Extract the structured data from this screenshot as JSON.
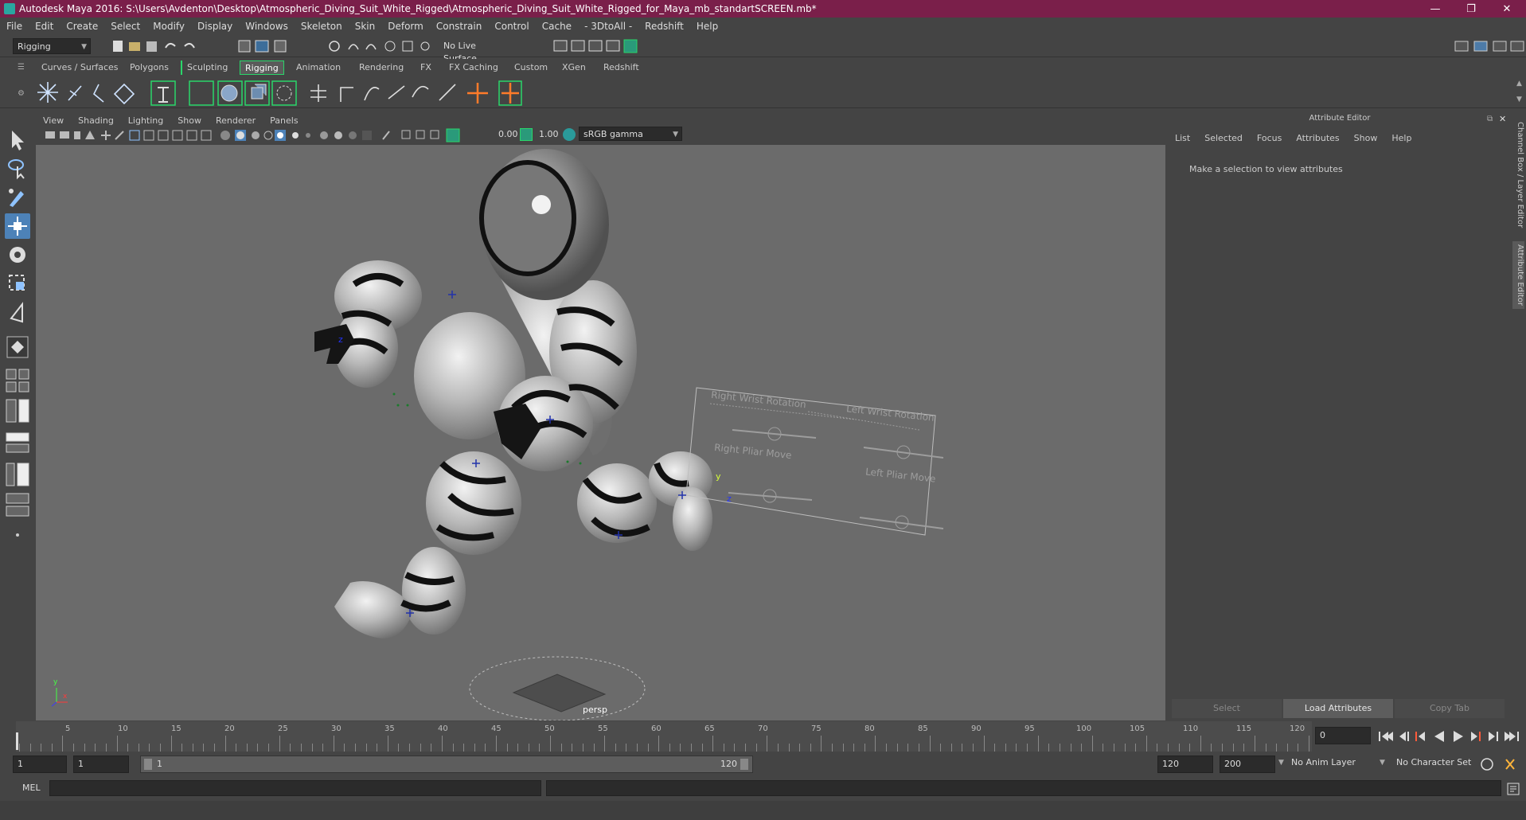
{
  "window": {
    "title": "Autodesk Maya 2016: S:\\Users\\Avdenton\\Desktop\\Atmospheric_Diving_Suit_White_Rigged\\Atmospheric_Diving_Suit_White_Rigged_for_Maya_mb_standartSCREEN.mb*",
    "minimize": "—",
    "maximize": "❐",
    "close": "✕"
  },
  "menubar": [
    "File",
    "Edit",
    "Create",
    "Select",
    "Modify",
    "Display",
    "Windows",
    "Skeleton",
    "Skin",
    "Deform",
    "Constrain",
    "Control",
    "Cache",
    "- 3DtoAll -",
    "Redshift",
    "Help"
  ],
  "statusline": {
    "mode": "Rigging",
    "live_surface": "No Live Surface"
  },
  "shelf_tabs": [
    {
      "label": "Curves / Surfaces",
      "active": false
    },
    {
      "label": "Polygons",
      "active": false
    },
    {
      "label": "Sculpting",
      "active": false
    },
    {
      "label": "Rigging",
      "active": true
    },
    {
      "label": "Animation",
      "active": false
    },
    {
      "label": "Rendering",
      "active": false
    },
    {
      "label": "FX",
      "active": false
    },
    {
      "label": "FX Caching",
      "active": false
    },
    {
      "label": "Custom",
      "active": false
    },
    {
      "label": "XGen",
      "active": false
    },
    {
      "label": "Redshift",
      "active": false
    }
  ],
  "viewport": {
    "menu": [
      "View",
      "Shading",
      "Lighting",
      "Show",
      "Renderer",
      "Panels"
    ],
    "exposure": "0.00",
    "gamma": "1.00",
    "color_space": "sRGB gamma",
    "camera": "persp",
    "axis_labels": {
      "y": "y",
      "z": "z",
      "x": "x"
    },
    "control_labels": [
      "Right Wrist Rotation",
      "Left Wrist Rotation",
      "Right Pliar Move",
      "Left Pliar Move"
    ]
  },
  "attribute_editor": {
    "header": "Attribute Editor",
    "menu": [
      "List",
      "Selected",
      "Focus",
      "Attributes",
      "Show",
      "Help"
    ],
    "message": "Make a selection to view attributes",
    "buttons": {
      "select": "Select",
      "load": "Load Attributes",
      "copy": "Copy Tab"
    }
  },
  "side_tabs": [
    "Channel Box / Layer Editor",
    "Attribute Editor"
  ],
  "timeline": {
    "ticks": [
      "5",
      "10",
      "15",
      "20",
      "25",
      "30",
      "35",
      "40",
      "45",
      "50",
      "55",
      "60",
      "65",
      "70",
      "75",
      "80",
      "85",
      "90",
      "95",
      "100",
      "105",
      "110",
      "115",
      "120"
    ],
    "current_frame": "0"
  },
  "range": {
    "start": "1",
    "playback_start": "1",
    "slider_start": "1",
    "slider_end": "120",
    "playback_end": "120",
    "end": "200",
    "anim_layer": "No Anim Layer",
    "character_set": "No Character Set"
  },
  "commandline": {
    "label": "MEL"
  },
  "colors": {
    "titlebar": "#7a1f4a",
    "accent": "#2ad66a",
    "viewport_bg": "#6b6b6b"
  }
}
